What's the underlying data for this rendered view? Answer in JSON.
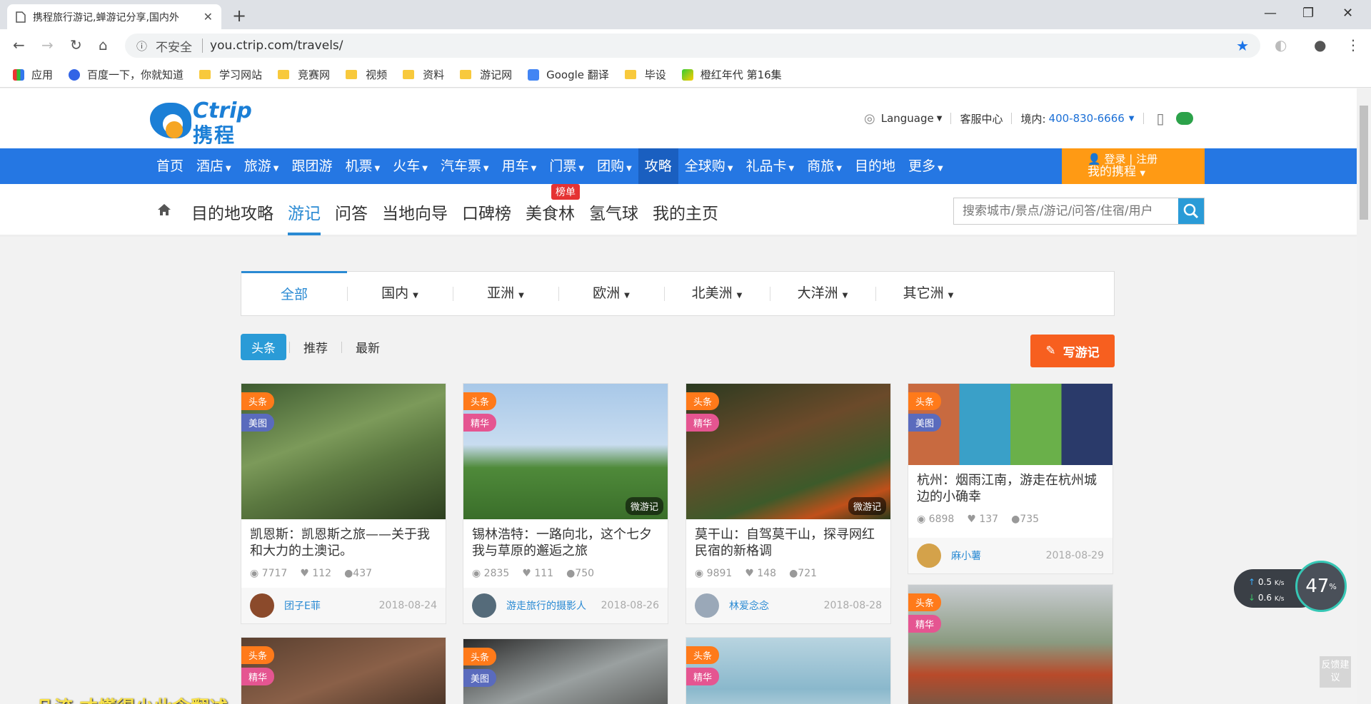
{
  "browser": {
    "tab_title": "携程旅行游记,蝉游记分享,国内外",
    "security": "不安全",
    "url": "you.ctrip.com/travels/",
    "bookmarks": [
      "应用",
      "百度一下，你就知道",
      "学习网站",
      "竞赛网",
      "视频",
      "资料",
      "游记网",
      "Google 翻译",
      "毕设",
      "橙红年代 第16集"
    ]
  },
  "header": {
    "logo_en": "Ctrip",
    "logo_cn": "携程",
    "language": "Language",
    "service": "客服中心",
    "domestic_label": "境内:",
    "phone": "400-830-6666"
  },
  "mainnav": {
    "items": [
      "首页",
      "酒店",
      "旅游",
      "跟团游",
      "机票",
      "火车",
      "汽车票",
      "用车",
      "门票",
      "团购",
      "攻略",
      "全球购",
      "礼品卡",
      "商旅",
      "目的地",
      "更多"
    ],
    "login": "登录",
    "register": "注册",
    "my_ctrip": "我的携程"
  },
  "subnav": {
    "items": [
      "目的地攻略",
      "游记",
      "问答",
      "当地向导",
      "口碑榜",
      "美食林",
      "氢气球",
      "我的主页"
    ],
    "badge": "榜单",
    "search_placeholder": "搜索城市/景点/游记/问答/住宿/用户"
  },
  "regions": [
    "全部",
    "国内",
    "亚洲",
    "欧洲",
    "北美洲",
    "大洋洲",
    "其它洲"
  ],
  "filters": [
    "头条",
    "推荐",
    "最新"
  ],
  "write_button": "写游记",
  "cards": [
    {
      "tags": [
        "头条",
        "美图"
      ],
      "title": "凯恩斯：凯恩斯之旅——关于我和大力的土澳记。",
      "views": "7717",
      "likes": "112",
      "comments": "437",
      "author": "团子E菲",
      "date": "2018-08-24",
      "micro": ""
    },
    {
      "tags": [
        "头条",
        "精华"
      ],
      "title": "锡林浩特：一路向北，这个七夕我与草原的邂逅之旅",
      "views": "2835",
      "likes": "111",
      "comments": "750",
      "author": "游走旅行的摄影人",
      "date": "2018-08-26",
      "micro": "微游记"
    },
    {
      "tags": [
        "头条",
        "精华"
      ],
      "title": "莫干山：自驾莫干山，探寻网红民宿的新格调",
      "views": "9891",
      "likes": "148",
      "comments": "721",
      "author": "林爱念念",
      "date": "2018-08-28",
      "micro": "微游记"
    },
    {
      "tags": [
        "头条",
        "美图"
      ],
      "title": "杭州：烟雨江南，游走在杭州城边的小确幸",
      "views": "6898",
      "likes": "137",
      "comments": "735",
      "author": "麻小薯",
      "date": "2018-08-29",
      "micro": ""
    }
  ],
  "cards_row2_tags": [
    [
      "头条",
      "精华"
    ],
    [
      "头条",
      "美图"
    ],
    [
      "头条",
      "精华"
    ],
    [
      "头条",
      "精华"
    ]
  ],
  "speed": {
    "up": "0.5",
    "down": "0.6",
    "unit": "K/s",
    "percent": "47"
  },
  "feedback": "反馈建议",
  "caption": "凡流 才懂得少此念翻述"
}
